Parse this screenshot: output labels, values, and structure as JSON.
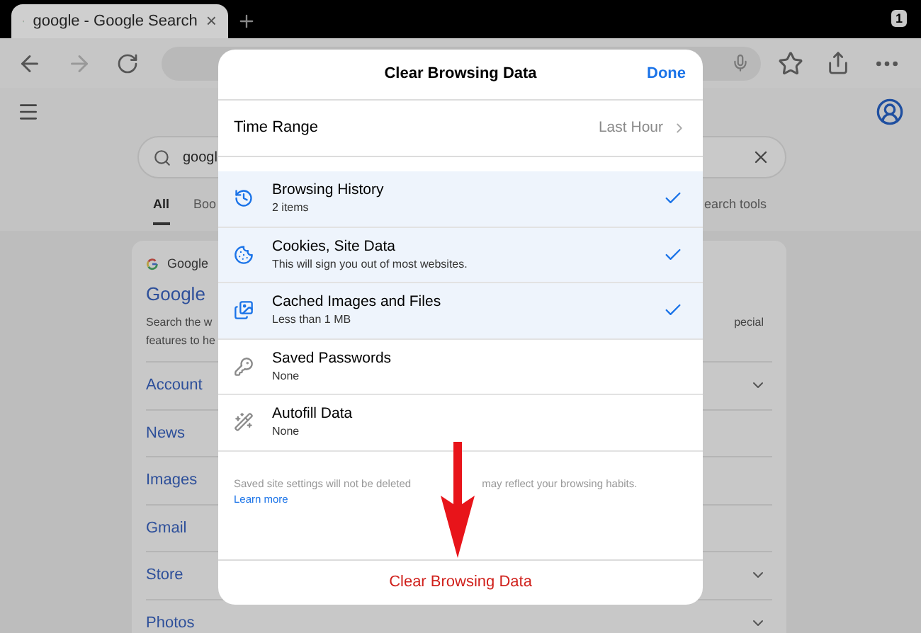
{
  "browser": {
    "tab": {
      "title": "google - Google Search",
      "close": "×"
    },
    "tab_count": "1"
  },
  "page": {
    "search": {
      "value": "googl"
    },
    "filters": [
      {
        "label": "All",
        "selected": true
      },
      {
        "label": "Boo",
        "selected": false
      },
      {
        "label": "earch tools",
        "selected": false
      }
    ],
    "result": {
      "source": "Google",
      "title": "Google",
      "snippet_left": [
        "Search the w",
        "features to he"
      ],
      "snippet_right": [
        "pecial"
      ],
      "links": [
        {
          "label": "Account",
          "has_submenu": true
        },
        {
          "label": "News",
          "has_submenu": false
        },
        {
          "label": "Images",
          "has_submenu": false
        },
        {
          "label": "Gmail",
          "has_submenu": false
        },
        {
          "label": "Store",
          "has_submenu": true
        },
        {
          "label": "Photos",
          "has_submenu": true
        }
      ]
    }
  },
  "dialog": {
    "title": "Clear Browsing Data",
    "done": "Done",
    "time_range": {
      "label": "Time Range",
      "value": "Last Hour"
    },
    "items": [
      {
        "title": "Browsing History",
        "subtitle": "2 items",
        "checked": true
      },
      {
        "title": "Cookies, Site Data",
        "subtitle": "This will sign you out of most websites.",
        "checked": true
      },
      {
        "title": "Cached Images and Files",
        "subtitle": "Less than 1 MB",
        "checked": true
      },
      {
        "title": "Saved Passwords",
        "subtitle": "None",
        "checked": false
      },
      {
        "title": "Autofill Data",
        "subtitle": "None",
        "checked": false
      }
    ],
    "note_parts": [
      "Saved site settings will not be deleted",
      "may reflect your browsing habits."
    ],
    "learn_more": "Learn more",
    "clear_button": "Clear Browsing Data"
  }
}
